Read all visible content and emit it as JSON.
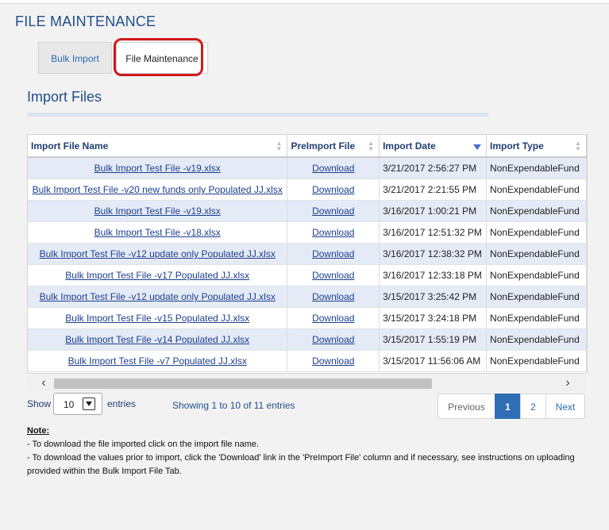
{
  "page": {
    "title": "FILE MAINTENANCE"
  },
  "tabs": [
    {
      "label": "Bulk Import",
      "active": false
    },
    {
      "label": "File Maintenance",
      "active": true
    }
  ],
  "section": {
    "title": "Import Files"
  },
  "table": {
    "columns": [
      "Import File Name",
      "PreImport File",
      "Import Date",
      "Import Type"
    ],
    "sort": {
      "column": "Import Date",
      "direction": "descending"
    },
    "rows": [
      {
        "name": "Bulk Import Test File -v19.xlsx",
        "pre": "Download",
        "date": "3/21/2017 2:56:27 PM",
        "type": "NonExpendableFund"
      },
      {
        "name": "Bulk Import Test File -v20 new funds only Populated JJ.xlsx",
        "pre": "Download",
        "date": "3/21/2017 2:21:55 PM",
        "type": "NonExpendableFund"
      },
      {
        "name": "Bulk Import Test File -v19.xlsx",
        "pre": "Download",
        "date": "3/16/2017 1:00:21 PM",
        "type": "NonExpendableFund"
      },
      {
        "name": "Bulk Import Test File -v18.xlsx",
        "pre": "Download",
        "date": "3/16/2017 12:51:32 PM",
        "type": "NonExpendableFund"
      },
      {
        "name": "Bulk Import Test File -v12 update only Populated JJ.xlsx",
        "pre": "Download",
        "date": "3/16/2017 12:38:32 PM",
        "type": "NonExpendableFund"
      },
      {
        "name": "Bulk Import Test File -v17 Populated JJ.xlsx",
        "pre": "Download",
        "date": "3/16/2017 12:33:18 PM",
        "type": "NonExpendableFund"
      },
      {
        "name": "Bulk Import Test File -v12 update only Populated JJ.xlsx",
        "pre": "Download",
        "date": "3/15/2017 3:25:42 PM",
        "type": "NonExpendableFund"
      },
      {
        "name": "Bulk Import Test File -v15 Populated JJ.xlsx",
        "pre": "Download",
        "date": "3/15/2017 3:24:18 PM",
        "type": "NonExpendableFund"
      },
      {
        "name": "Bulk Import Test File -v14 Populated JJ.xlsx",
        "pre": "Download",
        "date": "3/15/2017 1:55:19 PM",
        "type": "NonExpendableFund"
      },
      {
        "name": "Bulk Import Test File -v7 Populated JJ.xlsx",
        "pre": "Download",
        "date": "3/15/2017 11:56:06 AM",
        "type": "NonExpendableFund"
      }
    ]
  },
  "length": {
    "show_label": "Show",
    "value": "10",
    "entries_label": "entries"
  },
  "info": "Showing 1 to 10 of 11 entries",
  "pagination": {
    "previous": "Previous",
    "pages": [
      "1",
      "2"
    ],
    "current": "1",
    "next": "Next"
  },
  "note": {
    "title": "Note:",
    "lines": [
      "- To download the file imported click on the import file name.",
      "- To download the values prior to import, click the 'Download' link in the 'PreImport File' column and if necessary, see instructions on uploading provided within the Bulk Import File Tab."
    ]
  },
  "colors": {
    "title": "#1f4e8a",
    "row_alt": "#e4ebf7",
    "page_active": "#2f6eb5",
    "highlight": "#d0181c"
  }
}
